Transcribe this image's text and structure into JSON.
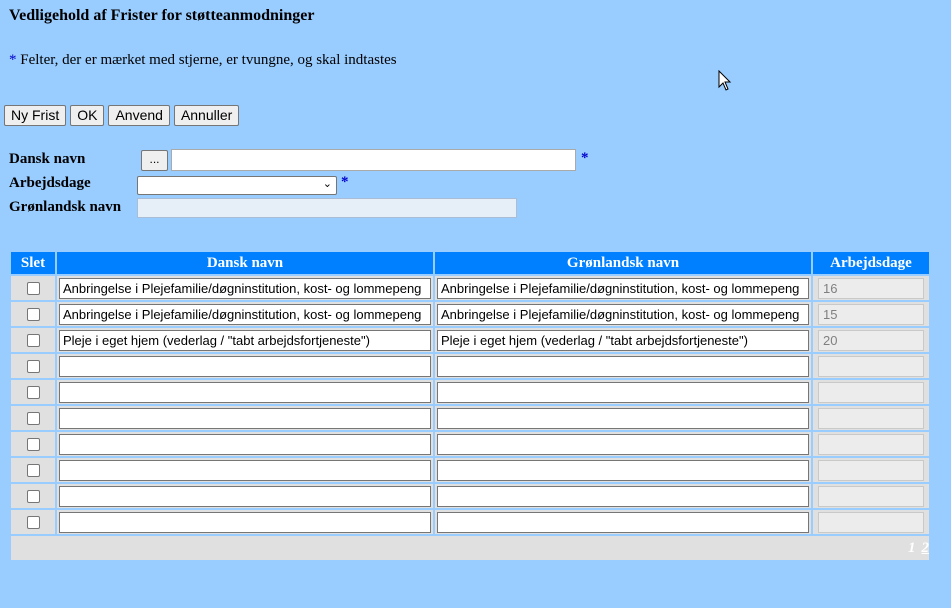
{
  "page": {
    "title": "Vedligehold af Frister for støtteanmodninger",
    "note_star": "*",
    "note_text": " Felter, der er mærket med stjerne, er tvungne, og skal indtastes"
  },
  "toolbar": {
    "new_label": "Ny Frist",
    "ok_label": "OK",
    "apply_label": "Anvend",
    "cancel_label": "Annuller"
  },
  "form": {
    "dansk_label": "Dansk navn",
    "lookup_label": "...",
    "arbejdsdage_label": "Arbejdsdage",
    "gronlandsk_label": "Grønlandsk navn",
    "required_marker": "*"
  },
  "table": {
    "headers": [
      "Slet",
      "Dansk navn",
      "Grønlandsk navn",
      "Arbejdsdage"
    ],
    "rows": [
      {
        "dansk": "Anbringelse i Plejefamilie/døgninstitution, kost- og lommepeng",
        "gronlandsk": "Anbringelse i Plejefamilie/døgninstitution, kost- og lommepeng",
        "dage": "16"
      },
      {
        "dansk": "Anbringelse i Plejefamilie/døgninstitution, kost- og lommepeng",
        "gronlandsk": "Anbringelse i Plejefamilie/døgninstitution, kost- og lommepeng",
        "dage": "15"
      },
      {
        "dansk": "Pleje i eget hjem (vederlag / \"tabt arbejdsfortjeneste\")",
        "gronlandsk": "Pleje i eget hjem (vederlag / \"tabt arbejdsfortjeneste\")",
        "dage": "20"
      },
      {
        "dansk": "",
        "gronlandsk": "",
        "dage": ""
      },
      {
        "dansk": "",
        "gronlandsk": "",
        "dage": ""
      },
      {
        "dansk": "",
        "gronlandsk": "",
        "dage": ""
      },
      {
        "dansk": "",
        "gronlandsk": "",
        "dage": ""
      },
      {
        "dansk": "",
        "gronlandsk": "",
        "dage": ""
      },
      {
        "dansk": "",
        "gronlandsk": "",
        "dage": ""
      },
      {
        "dansk": "",
        "gronlandsk": "",
        "dage": ""
      }
    ]
  },
  "pager": {
    "current": "1",
    "next": "2"
  },
  "colors": {
    "background": "#99ccff",
    "header": "#0080ff",
    "required": "#0000cc"
  },
  "icons": {
    "cursor": "mouse-pointer-icon",
    "dropdown": "chevron-down-icon"
  }
}
